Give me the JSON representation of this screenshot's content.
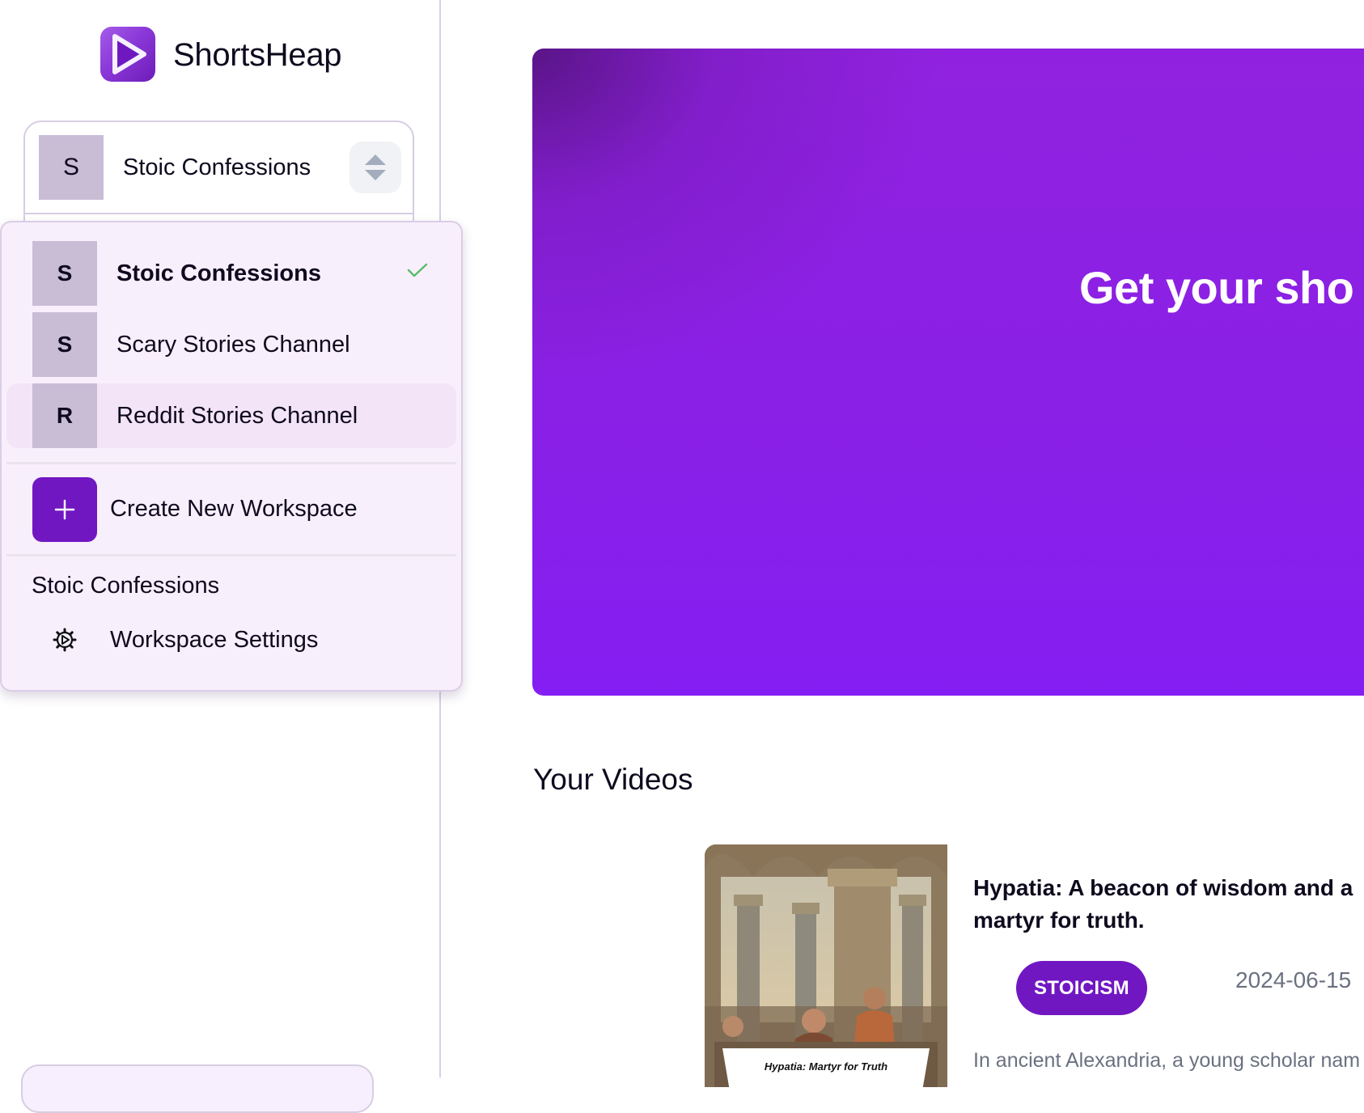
{
  "app": {
    "brand_name": "ShortsHeap",
    "accent_color": "#7117c2"
  },
  "sidebar": {
    "workspace_selector": {
      "avatar_letter": "S",
      "name": "Stoic Confessions",
      "toggle_icon": "chevron-up-down-icon"
    }
  },
  "workspace_menu": {
    "workspaces": [
      {
        "avatar_letter": "S",
        "name": "Stoic Confessions",
        "selected": true,
        "highlighted": false
      },
      {
        "avatar_letter": "S",
        "name": "Scary Stories Channel",
        "selected": false,
        "highlighted": false
      },
      {
        "avatar_letter": "R",
        "name": "Reddit Stories Channel",
        "selected": false,
        "highlighted": true
      }
    ],
    "create_label": "Create New Workspace",
    "create_icon": "plus-icon",
    "current_section_label": "Stoic Confessions",
    "settings_label": "Workspace Settings",
    "settings_icon": "gear-icon",
    "selected_icon": "check-icon"
  },
  "main": {
    "banner": {
      "headline": "Get your sho"
    },
    "videos_section": {
      "title": "Your Videos",
      "videos": [
        {
          "thumbnail_caption": "Hypatia: Martyr for Truth",
          "title": "Hypatia: A beacon of wisdom and a martyr for truth.",
          "tag": "STOICISM",
          "date": "2024-06-15",
          "description": "In ancient Alexandria, a young scholar nam"
        }
      ]
    }
  }
}
